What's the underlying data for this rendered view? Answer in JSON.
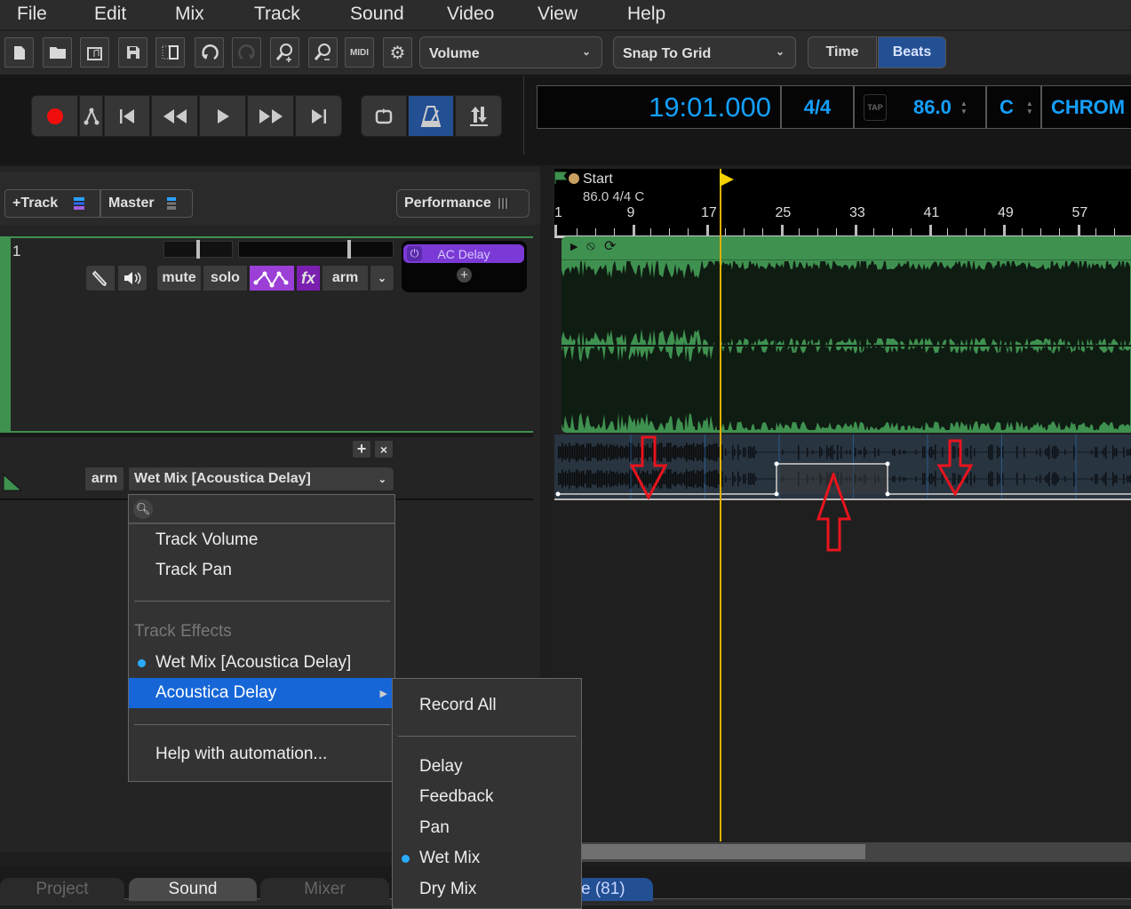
{
  "menubar": {
    "items": [
      "File",
      "Edit",
      "Mix",
      "Track",
      "Sound",
      "Video",
      "View",
      "Help"
    ]
  },
  "toolbar": {
    "icons": [
      "new-file-icon",
      "open-folder-icon",
      "import-audio-icon",
      "save-icon",
      "crop-icon",
      "undo-icon",
      "redo-icon",
      "zoom-in-icon",
      "zoom-out-icon",
      "midi-icon",
      "settings-icon"
    ],
    "midi_label": "MIDI",
    "automation_select": "Volume",
    "snap_select": "Snap To Grid",
    "time_label": "Time",
    "beats_label": "Beats"
  },
  "transport": {
    "time": "19:01.000",
    "time_signature": "4/4",
    "tap_label": "TAP",
    "tempo": "86.0",
    "key": "C",
    "scale": "CHROM"
  },
  "track_header": {
    "add_track_label": "+Track",
    "master_label": "Master",
    "performance_label": "Performance"
  },
  "track": {
    "number": "1",
    "mute_label": "mute",
    "solo_label": "solo",
    "fx_label": "fx",
    "arm_label": "arm",
    "effect_name": "AC Delay",
    "add_effect_label": "+"
  },
  "automation_lane": {
    "add_label": "+",
    "close_label": "×",
    "arm_label": "arm",
    "parameter_select": "Wet Mix [Acoustica Delay]"
  },
  "automation_menu": {
    "search_placeholder": "",
    "items": [
      {
        "label": "Track Volume"
      },
      {
        "label": "Track Pan"
      },
      {
        "label": "Track Effects",
        "header": true
      },
      {
        "label": "Wet Mix [Acoustica Delay]",
        "selected": true
      },
      {
        "label": "Acoustica Delay",
        "highlighted": true,
        "submenu": true
      },
      {
        "label": "Help with automation..."
      }
    ]
  },
  "submenu": {
    "items": [
      {
        "label": "Record All"
      },
      {
        "label": "Delay"
      },
      {
        "label": "Feedback"
      },
      {
        "label": "Pan"
      },
      {
        "label": "Wet Mix",
        "selected": true
      },
      {
        "label": "Dry Mix"
      }
    ]
  },
  "ruler": {
    "marker_label": "Start",
    "marker_info": "86.0 4/4 C",
    "bars": [
      "1",
      "9",
      "17",
      "25",
      "33",
      "41",
      "49",
      "57"
    ]
  },
  "bottom_tabs": {
    "project": "Project",
    "sound": "Sound",
    "mixer": "Mixer",
    "partial_tab": "e (81)"
  },
  "colors": {
    "accent_blue": "#234f93",
    "lcd_text": "#14a0ff",
    "track_green": "#3f9150",
    "fx_purple": "#9b3fd6",
    "menu_highlight": "#1666d8",
    "playhead": "#e0b000",
    "annotation_red": "#e8141e"
  }
}
